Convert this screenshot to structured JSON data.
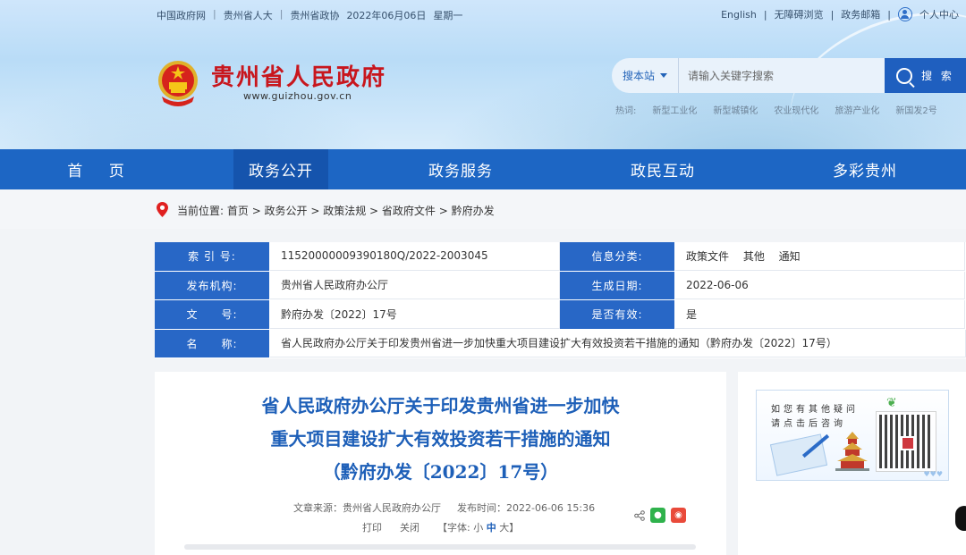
{
  "topbar": {
    "items": [
      "中国政府网",
      "贵州省人大",
      "贵州省政协"
    ],
    "date": "2022年06月06日",
    "weekday": "星期一"
  },
  "toplinks": {
    "english": "English",
    "accessibility": "无障碍浏览",
    "mail": "政务邮箱",
    "user_center": "个人中心"
  },
  "site": {
    "title": "贵州省人民政府",
    "url": "www.guizhou.gov.cn"
  },
  "search": {
    "scope": "搜本站",
    "placeholder": "请输入关键字搜索",
    "button": "搜 索"
  },
  "hotwords": {
    "label": "热词:",
    "items": [
      "新型工业化",
      "新型城镇化",
      "农业现代化",
      "旅游产业化",
      "新国发2号"
    ]
  },
  "nav": {
    "items": [
      "首 页",
      "政务公开",
      "政务服务",
      "政民互动",
      "多彩贵州"
    ],
    "active": "政务公开"
  },
  "breadcrumb": {
    "label": "当前位置:",
    "path": "首页 > 政务公开 > 政策法规 > 省政府文件 > 黔府办发"
  },
  "info": {
    "index_label": "索 引 号:",
    "index_value": "11520000009390180Q/2022-2003045",
    "category_label": "信息分类:",
    "category_value": "政策文件　 其他　 通知",
    "publisher_label": "发布机构:",
    "publisher_value": "贵州省人民政府办公厅",
    "date_label": "生成日期:",
    "date_value": "2022-06-06",
    "docno_label": "文　　号:",
    "docno_value": "黔府办发〔2022〕17号",
    "valid_label": "是否有效:",
    "valid_value": "是",
    "name_label": "名　　称:",
    "name_value": "省人民政府办公厅关于印发贵州省进一步加快重大项目建设扩大有效投资若干措施的通知（黔府办发〔2022〕17号）"
  },
  "article": {
    "title_line1": "省人民政府办公厅关于印发贵州省进一步加快",
    "title_line2": "重大项目建设扩大有效投资若干措施的通知",
    "title_line3": "（黔府办发〔2022〕17号）",
    "source": "文章来源：贵州省人民政府办公厅",
    "published": "发布时间：2022-06-06 15:36",
    "print": "打印",
    "close": "关闭",
    "font_label": "【字体:",
    "font_small": "小",
    "font_mid": "中",
    "font_large": "大】"
  },
  "side": {
    "line1": "如您有其他疑问",
    "line2": "请点击后咨询",
    "hearts": "♥♥♥"
  }
}
